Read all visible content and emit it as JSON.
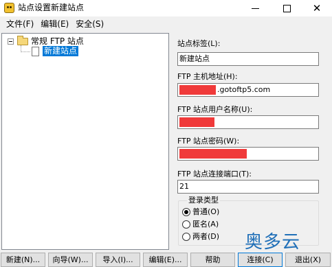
{
  "window": {
    "title": "站点设置新建站点",
    "minimize_icon": "minimize-icon",
    "maximize_icon": "maximize-icon",
    "close_icon": "close-icon",
    "close_glyph": "✕"
  },
  "menu": {
    "items": [
      "文件(F)",
      "编辑(E)",
      "安全(S)"
    ]
  },
  "tree": {
    "root_label": "常规 FTP 站点",
    "root_expander": "−",
    "child_label": "新建站点"
  },
  "form": {
    "site_tag_label": "站点标签(L):",
    "site_tag_value": "新建站点",
    "host_label": "FTP 主机地址(H):",
    "host_value_suffix": ".gotoftp5.com",
    "user_label": "FTP 站点用户名称(U):",
    "password_label": "FTP 站点密码(W):",
    "port_label": "FTP 站点连接端口(T):",
    "port_value": "21"
  },
  "login_type": {
    "title": "登录类型",
    "options": [
      {
        "label": "普通(O)",
        "selected": true
      },
      {
        "label": "匿名(A)",
        "selected": false
      },
      {
        "label": "两者(D)",
        "selected": false
      }
    ]
  },
  "watermark": "奥多云",
  "buttons": {
    "new": "新建(N)...",
    "wizard": "向导(W)...",
    "import": "导入(I)...",
    "edit": "编辑(E)...",
    "help": "帮助",
    "connect": "连接(C)",
    "exit": "退出(X)"
  },
  "colors": {
    "selection": "#0078d7",
    "redaction": "#f03a3a",
    "watermark": "#1f6fb8"
  }
}
